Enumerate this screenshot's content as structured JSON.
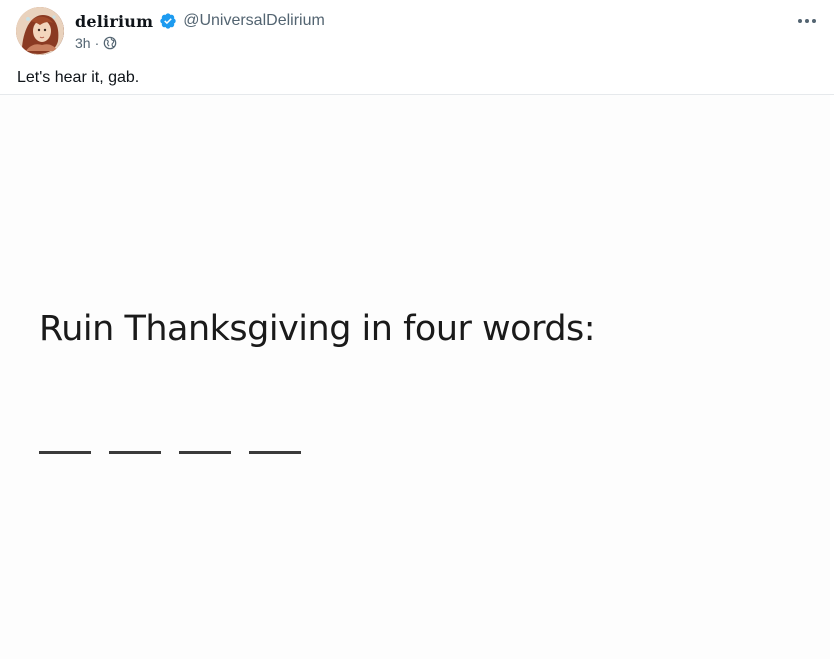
{
  "post": {
    "author": {
      "display_name": "delirium",
      "handle": "@UniversalDelirium",
      "verified": true,
      "avatar_icon": "avatar-portrait"
    },
    "timestamp": "3h",
    "separator": "·",
    "visibility_icon": "globe-icon",
    "more_icon": "more-dots-icon",
    "text": "Let's hear it, gab.",
    "media": {
      "headline": "Ruin Thanksgiving in four words:",
      "blanks": [
        "___",
        "___",
        "___",
        "___"
      ]
    }
  },
  "colors": {
    "text_primary": "#0f1419",
    "text_secondary": "#536471",
    "verified_blue": "#1d9bf0",
    "divider": "#e6e9ec"
  }
}
